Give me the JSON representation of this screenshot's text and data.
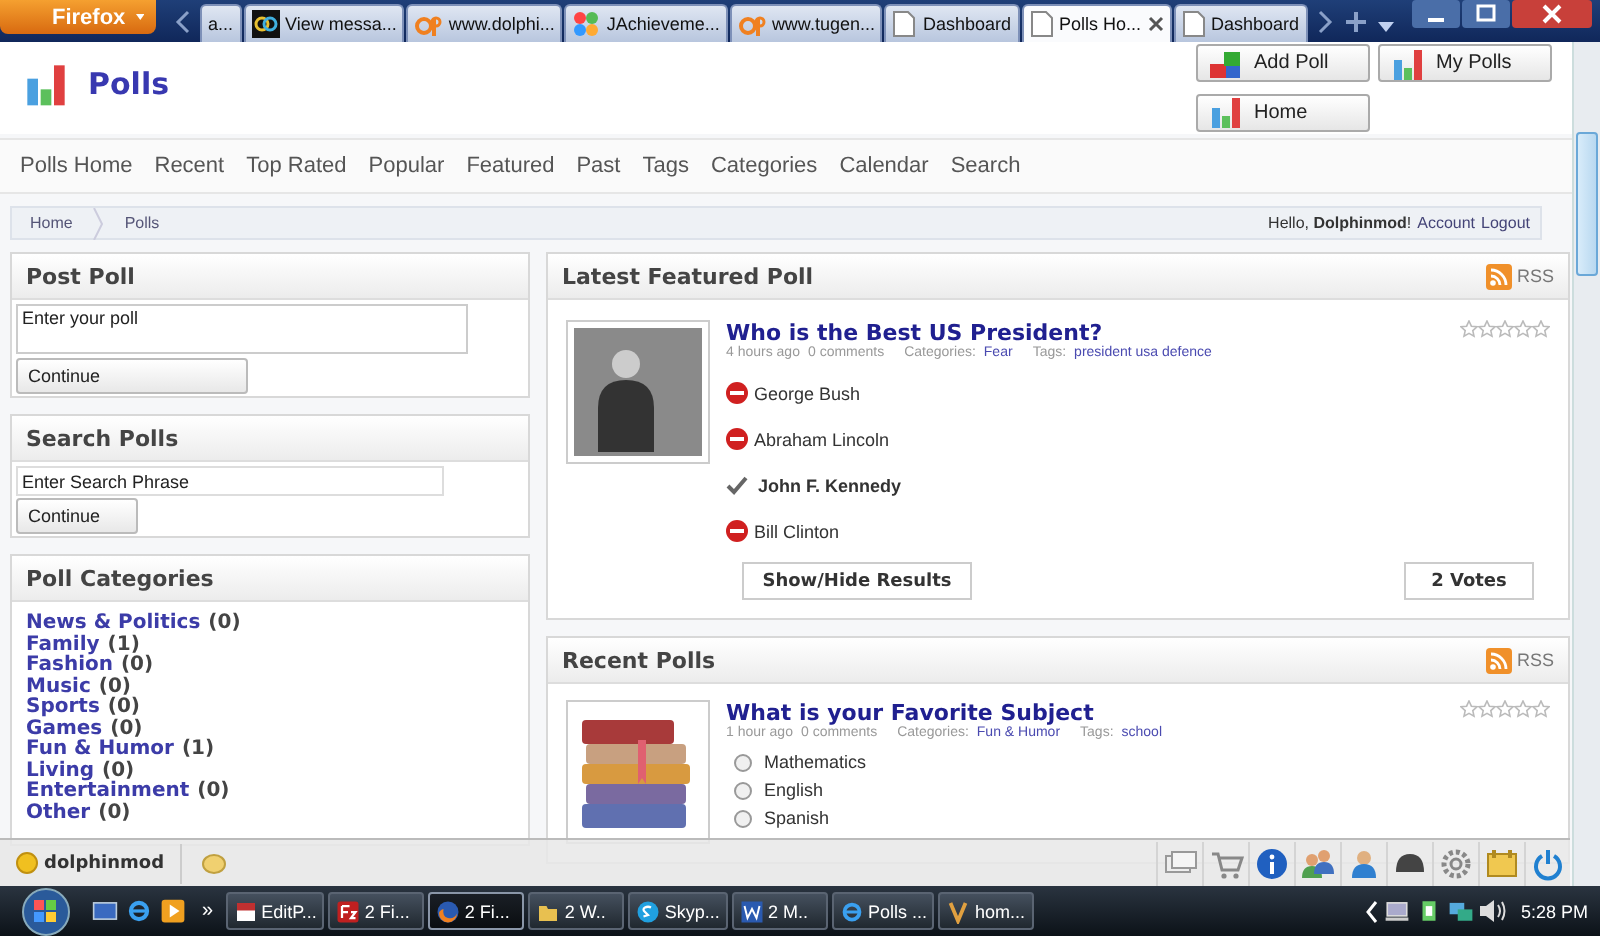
{
  "browser": {
    "menu_button": "Firefox",
    "tabs": [
      {
        "label": "a...",
        "selected": false
      },
      {
        "label": "View messa...",
        "selected": false
      },
      {
        "label": "www.dolphi...",
        "selected": false
      },
      {
        "label": "JAchieveme...",
        "selected": false
      },
      {
        "label": "www.tugen...",
        "selected": false
      },
      {
        "label": "Dashboard",
        "selected": false
      },
      {
        "label": "Polls Ho...",
        "selected": true
      },
      {
        "label": "Dashboard",
        "selected": false
      }
    ]
  },
  "header": {
    "title": "Polls",
    "buttons": [
      {
        "label": "Add Poll",
        "kind": "add"
      },
      {
        "label": "My Polls",
        "kind": "chart"
      },
      {
        "label": "Home",
        "kind": "chart"
      }
    ]
  },
  "nav": [
    "Polls Home",
    "Recent",
    "Top Rated",
    "Popular",
    "Featured",
    "Past",
    "Tags",
    "Categories",
    "Calendar",
    "Search"
  ],
  "breadcrumb": [
    "Home",
    "Polls"
  ],
  "account": {
    "greeting": "Hello, **Dolphinmod**!",
    "links": [
      "Account",
      "Logout"
    ]
  },
  "post_poll": {
    "title": "Post Poll",
    "value": "Enter your poll",
    "button": "Continue"
  },
  "search_polls": {
    "title": "Search Polls",
    "value": "Enter Search Phrase",
    "button": "Continue"
  },
  "poll_categories": {
    "title": "Poll Categories",
    "items": [
      {
        "name": "News & Politics",
        "count": "(0)"
      },
      {
        "name": "Family",
        "count": "(1)"
      },
      {
        "name": "Fashion",
        "count": "(0)"
      },
      {
        "name": "Music",
        "count": "(0)"
      },
      {
        "name": "Sports",
        "count": "(0)"
      },
      {
        "name": "Games",
        "count": "(0)"
      },
      {
        "name": "Fun & Humor",
        "count": "(1)"
      },
      {
        "name": "Living",
        "count": "(0)"
      },
      {
        "name": "Entertainment",
        "count": "(0)"
      },
      {
        "name": "Other",
        "count": "(0)"
      }
    ]
  },
  "featured": {
    "title": "Latest Featured Poll",
    "rss": "RSS",
    "poll": {
      "question": "Who is the Best US President?",
      "time": "4 hours ago",
      "comments": "0 comments",
      "categories_label": "Categories:",
      "category": "Fear",
      "tags_label": "Tags:",
      "tags": "president usa defence",
      "stars": 0,
      "options": [
        {
          "label": "George Bush",
          "kind": "rejected"
        },
        {
          "label": "Abraham Lincoln",
          "kind": "rejected"
        },
        {
          "label": "John F. Kennedy",
          "kind": "voted"
        },
        {
          "label": "Bill Clinton",
          "kind": "rejected"
        }
      ],
      "results_button": "Show/Hide Results",
      "votes": "2 Votes"
    }
  },
  "recent": {
    "title": "Recent Polls",
    "rss": "RSS",
    "poll": {
      "question": "What is your Favorite Subject",
      "time": "1 hour ago",
      "comments": "0 comments",
      "categories_label": "Categories:",
      "category": "Fun & Humor",
      "tags_label": "Tags:",
      "tags": "school",
      "stars": 0,
      "options": [
        {
          "label": "Mathematics",
          "kind": "radio",
          "selected": false
        },
        {
          "label": "English",
          "kind": "radio",
          "selected": false
        },
        {
          "label": "Spanish",
          "kind": "radio",
          "selected": false
        }
      ]
    }
  },
  "toolbar": {
    "user": "dolphinmod"
  },
  "taskbar": {
    "more": "»",
    "tasks": [
      {
        "label": "EditP...",
        "selected": false
      },
      {
        "label": "2 Fi...",
        "selected": false
      },
      {
        "label": "2 Fi...",
        "selected": true
      },
      {
        "label": "2 W..",
        "selected": false
      },
      {
        "label": "Skyp...",
        "selected": false
      },
      {
        "label": "2 M..",
        "selected": false
      },
      {
        "label": "Polls ...",
        "selected": false
      },
      {
        "label": "hom...",
        "selected": false
      }
    ],
    "clock": "5:28 PM"
  }
}
